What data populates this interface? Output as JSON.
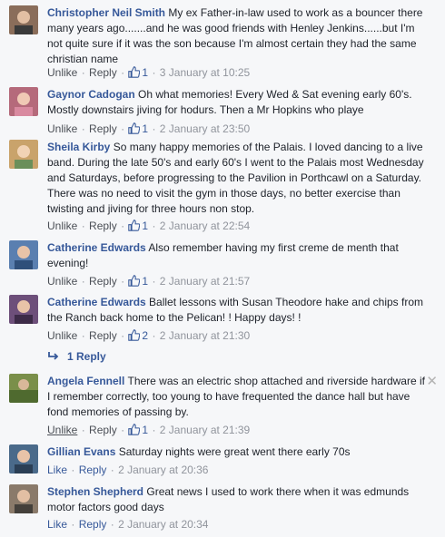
{
  "comments": [
    {
      "author": "Christopher Neil Smith",
      "text": "My ex Father-in-law used to work as a bouncer there many years ago.......and he was good friends with Henley Jenkins......but I'm not quite sure if it was the son because I'm almost certain they had the same christian name",
      "action1": "Unlike",
      "action2": "Reply",
      "likes": "1",
      "time": "3 January at 10:25",
      "avatar_color": "#8a6d5a"
    },
    {
      "author": "Gaynor Cadogan",
      "text": "Oh what memories! Every Wed & Sat evening early 60's. Mostly downstairs jiving for hodurs. Then a Mr Hopkins who playe",
      "action1": "Unlike",
      "action2": "Reply",
      "likes": "1",
      "time": "2 January at 23:50",
      "avatar_color": "#b56a7b"
    },
    {
      "author": "Sheila Kirby",
      "text": "So many happy memories of the Palais. I loved dancing to a live band. During the late 50's and early 60's I went to the Palais most Wednesday and Saturdays, before progressing to the Pavilion in Porthcawl on a Saturday. There was no need to visit the gym in those days, no better exercise than twisting and jiving for three hours non stop.",
      "action1": "Unlike",
      "action2": "Reply",
      "likes": "1",
      "time": "2 January at 22:54",
      "avatar_color": "#c9a36b"
    },
    {
      "author": "Catherine Edwards",
      "text": "Also remember having my first creme de menth that evening!",
      "action1": "Unlike",
      "action2": "Reply",
      "likes": "1",
      "time": "2 January at 21:57",
      "avatar_color": "#5a7fb0"
    },
    {
      "author": "Catherine Edwards",
      "text": "Ballet lessons with Susan Theodore hake and chips from the Ranch back home to the Pelican! ! Happy days! !",
      "action1": "Unlike",
      "action2": "Reply",
      "likes": "2",
      "time": "2 January at 21:30",
      "avatar_color": "#6d4f7a"
    },
    {
      "author": "Angela Fennell",
      "text": "There was an electric shop attached and riverside hardware if I remember correctly, too young to have frequented the dance hall but have fond memories of passing by.",
      "action1": "Unlike",
      "action2": "Reply",
      "likes": "1",
      "time": "2 January at 21:39",
      "avatar_color": "#7a8f4a"
    },
    {
      "author": "Gillian Evans",
      "text": "Saturday nights were great went there early 70s",
      "action1": "Like",
      "action2": "Reply",
      "likes": "",
      "time": "2 January at 20:36",
      "avatar_color": "#4a6a8a"
    },
    {
      "author": "Stephen Shepherd",
      "text": "Great news I used to work there when it was edmunds motor factors good days",
      "action1": "Like",
      "action2": "Reply",
      "likes": "",
      "time": "2 January at 20:34",
      "avatar_color": "#8a7a6a"
    }
  ],
  "reply_thread": {
    "label": "1 Reply"
  },
  "icons": {
    "like": "thumbs-up-icon",
    "reply": "reply-arrow-icon",
    "close": "close-icon"
  },
  "colors": {
    "link": "#365899",
    "meta": "#90949c",
    "text": "#1d2129",
    "background": "#f6f7f9"
  }
}
